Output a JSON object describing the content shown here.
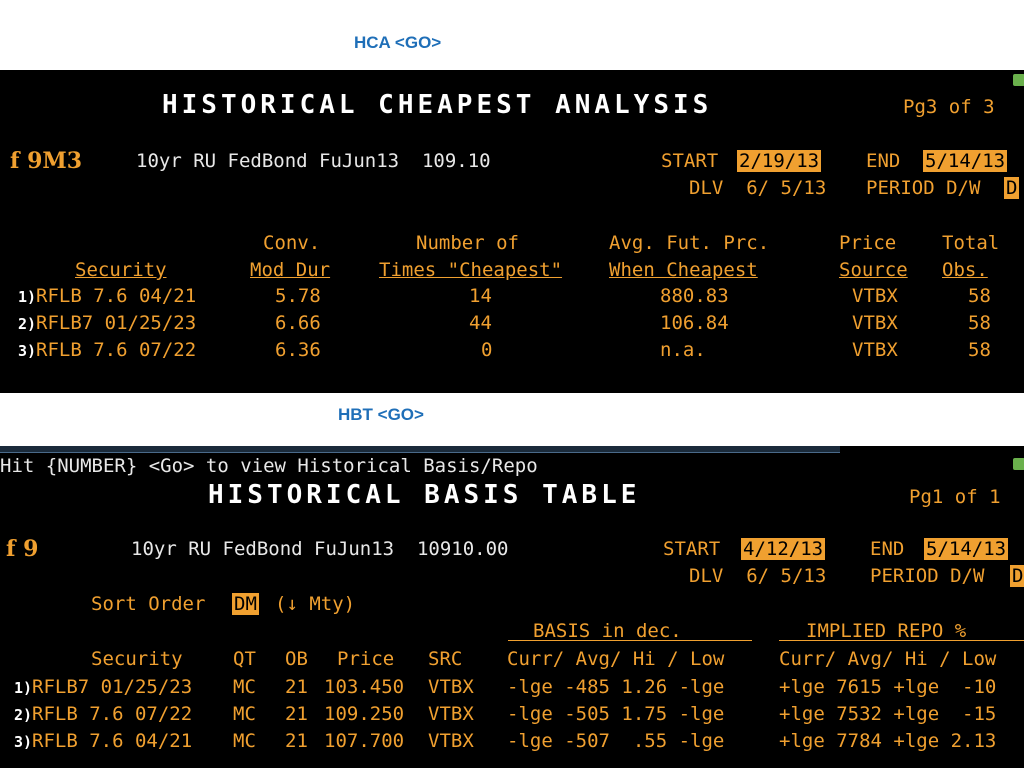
{
  "captions": {
    "hca": "HCA <GO>",
    "hbt": "HBT <GO>"
  },
  "hca": {
    "title": "HISTORICAL CHEAPEST ANALYSIS",
    "page": "Pg3 of 3",
    "fkey": "f 9M3",
    "instrument": "10yr RU FedBond FuJun13  109.10",
    "start_label": "START",
    "start_value": "2/19/13",
    "end_label": "END",
    "end_value": "5/14/13",
    "dlv": "DLV  6/ 5/13",
    "period_label": "PERIOD D/W",
    "period_value": "D",
    "headers": {
      "security": "Security",
      "conv1": "Conv.",
      "conv2": "Mod Dur",
      "num1": "Number of",
      "num2": "Times \"Cheapest\"",
      "avg1": "Avg. Fut. Prc.",
      "avg2": "When Cheapest",
      "price1": "Price",
      "price2": "Source",
      "total1": "Total",
      "total2": "Obs."
    },
    "rows": [
      {
        "n": "1)",
        "security": "RFLB 7.6 04/21",
        "moddur": "5.78",
        "times": "14",
        "avg": "880.83",
        "source": "VTBX",
        "obs": "58"
      },
      {
        "n": "2)",
        "security": "RFLB7 01/25/23",
        "moddur": "6.66",
        "times": "44",
        "avg": "106.84",
        "source": "VTBX",
        "obs": "58"
      },
      {
        "n": "3)",
        "security": "RFLB 7.6 07/22",
        "moddur": "6.36",
        "times": "0",
        "avg": "n.a.",
        "source": "VTBX",
        "obs": "58"
      }
    ]
  },
  "hbt": {
    "hint": "Hit {NUMBER} <Go> to view Historical Basis/Repo",
    "title": "HISTORICAL BASIS TABLE",
    "page": "Pg1 of 1",
    "fkey": "f 9",
    "instrument": "10yr RU FedBond FuJun13  10910.00",
    "start_label": "START",
    "start_value": "4/12/13",
    "end_label": "END",
    "end_value": "5/14/13",
    "dlv": "DLV  6/ 5/13",
    "period_label": "PERIOD D/W",
    "period_value": "D",
    "sort_label": "Sort Order",
    "sort_value": "DM",
    "sort_suffix": "(↓ Mty)",
    "basis_header": "BASIS in dec.",
    "repo_header": "IMPLIED REPO %",
    "headers": {
      "security": "Security",
      "qt": "QT",
      "ob": "OB",
      "price": "Price",
      "src": "SRC",
      "basis": "Curr/ Avg/ Hi / Low",
      "repo": "Curr/ Avg/ Hi / Low"
    },
    "rows": [
      {
        "n": "1)",
        "security": "RFLB7 01/25/23",
        "qt": "MC",
        "ob": "21",
        "price": "103.450",
        "src": "VTBX",
        "basis": "-lge -485 1.26 -lge",
        "repo": "+lge 7615 +lge  -10"
      },
      {
        "n": "2)",
        "security": "RFLB 7.6 07/22",
        "qt": "MC",
        "ob": "21",
        "price": "109.250",
        "src": "VTBX",
        "basis": "-lge -505 1.75 -lge",
        "repo": "+lge 7532 +lge  -15"
      },
      {
        "n": "3)",
        "security": "RFLB 7.6 04/21",
        "qt": "MC",
        "ob": "21",
        "price": "107.700",
        "src": "VTBX",
        "basis": "-lge -507  .55 -lge",
        "repo": "+lge 7784 +lge 2.13"
      }
    ]
  }
}
